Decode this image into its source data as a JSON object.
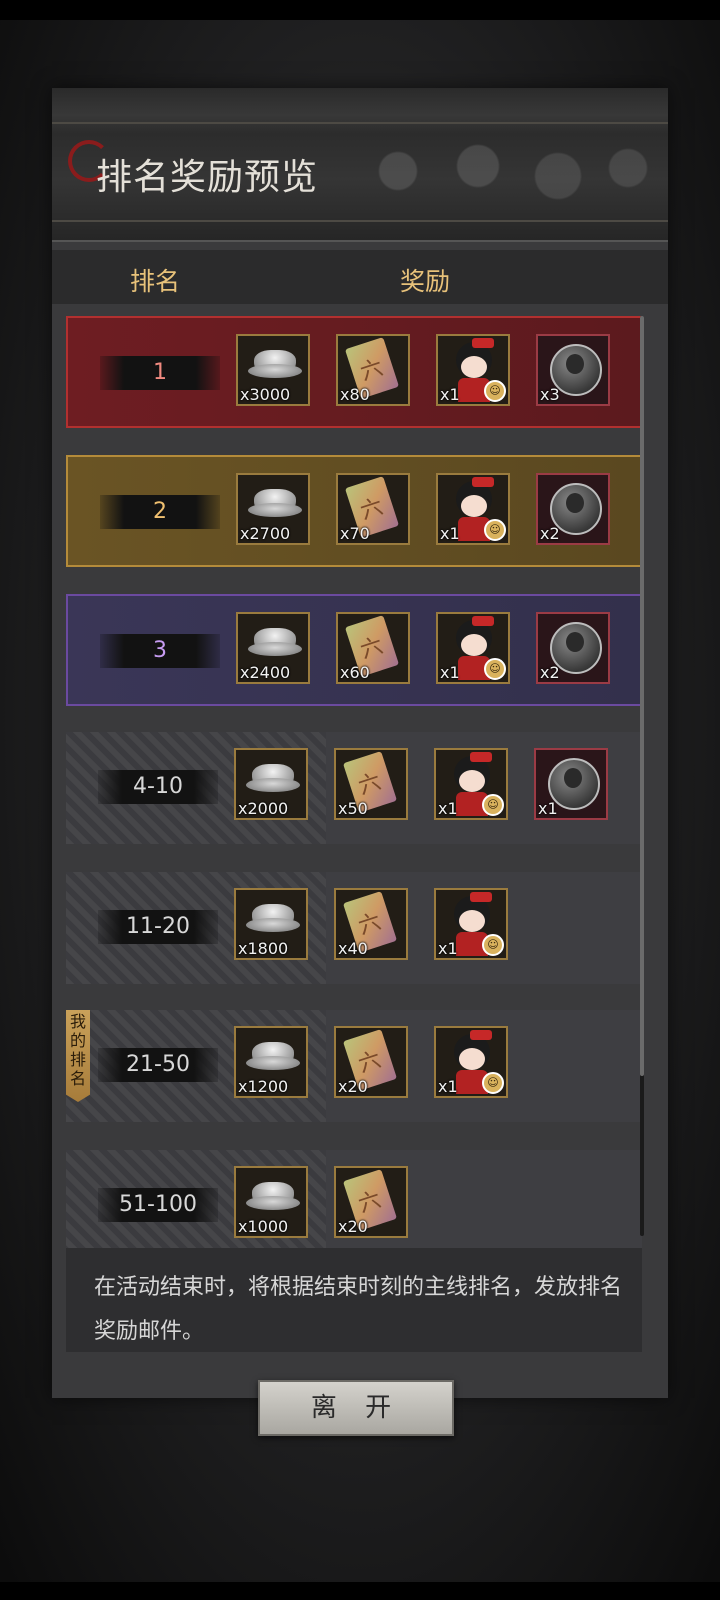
{
  "title": "排名奖励预览",
  "header": {
    "rank_label": "排名",
    "reward_label": "奖励"
  },
  "rows": [
    {
      "rank": "1",
      "items": [
        {
          "icon": "silver-ingot-icon",
          "qty": "x3000"
        },
        {
          "icon": "ticket-icon",
          "qty": "x80"
        },
        {
          "icon": "character-icon",
          "qty": "x1"
        },
        {
          "icon": "medal-icon",
          "qty": "x3"
        }
      ]
    },
    {
      "rank": "2",
      "items": [
        {
          "icon": "silver-ingot-icon",
          "qty": "x2700"
        },
        {
          "icon": "ticket-icon",
          "qty": "x70"
        },
        {
          "icon": "character-icon",
          "qty": "x1"
        },
        {
          "icon": "medal-icon",
          "qty": "x2"
        }
      ]
    },
    {
      "rank": "3",
      "items": [
        {
          "icon": "silver-ingot-icon",
          "qty": "x2400"
        },
        {
          "icon": "ticket-icon",
          "qty": "x60"
        },
        {
          "icon": "character-icon",
          "qty": "x1"
        },
        {
          "icon": "medal-icon",
          "qty": "x2"
        }
      ]
    },
    {
      "rank": "4-10",
      "items": [
        {
          "icon": "silver-ingot-icon",
          "qty": "x2000"
        },
        {
          "icon": "ticket-icon",
          "qty": "x50"
        },
        {
          "icon": "character-icon",
          "qty": "x1"
        },
        {
          "icon": "medal-icon",
          "qty": "x1"
        }
      ]
    },
    {
      "rank": "11-20",
      "items": [
        {
          "icon": "silver-ingot-icon",
          "qty": "x1800"
        },
        {
          "icon": "ticket-icon",
          "qty": "x40"
        },
        {
          "icon": "character-icon",
          "qty": "x1"
        }
      ]
    },
    {
      "rank": "21-50",
      "items": [
        {
          "icon": "silver-ingot-icon",
          "qty": "x1200"
        },
        {
          "icon": "ticket-icon",
          "qty": "x20"
        },
        {
          "icon": "character-icon",
          "qty": "x1"
        }
      ]
    },
    {
      "rank": "51-100",
      "items": [
        {
          "icon": "silver-ingot-icon",
          "qty": "x1000"
        },
        {
          "icon": "ticket-icon",
          "qty": "x20"
        }
      ]
    }
  ],
  "my_rank_tag": "我的排名",
  "description": "在活动结束时，将根据结束时刻的主线排名，发放排名奖励邮件。",
  "leave_button": "离 开",
  "colors": {
    "accent_gold": "#e8c27a",
    "rank1": "#b2302f",
    "rank2": "#b48b3a",
    "rank3": "#6b4aa0"
  }
}
